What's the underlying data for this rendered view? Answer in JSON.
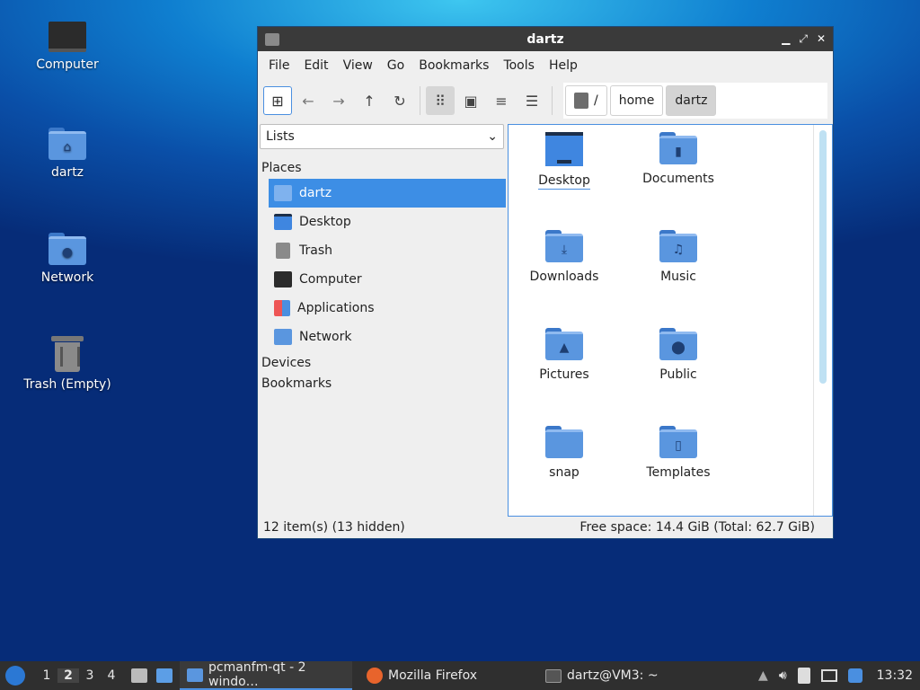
{
  "desktop": {
    "icons": [
      {
        "label": "Computer",
        "icon": "monitor-icon"
      },
      {
        "label": "dartz",
        "icon": "home-folder-icon"
      },
      {
        "label": "Network",
        "icon": "network-folder-icon"
      },
      {
        "label": "Trash (Empty)",
        "icon": "trash-icon"
      }
    ]
  },
  "window": {
    "title": "dartz",
    "menu": [
      "File",
      "Edit",
      "View",
      "Go",
      "Bookmarks",
      "Tools",
      "Help"
    ],
    "path": {
      "root": "/",
      "segments": [
        "home",
        "dartz"
      ]
    },
    "side": {
      "selector": "Lists",
      "groups": {
        "places": "Places",
        "devices": "Devices",
        "bookmarks": "Bookmarks"
      },
      "places": [
        "dartz",
        "Desktop",
        "Trash",
        "Computer",
        "Applications",
        "Network"
      ]
    },
    "files": [
      "Desktop",
      "Documents",
      "Downloads",
      "Music",
      "Pictures",
      "Public",
      "snap",
      "Templates"
    ],
    "status": {
      "left": "12 item(s) (13 hidden)",
      "right": "Free space: 14.4 GiB (Total: 62.7 GiB)"
    }
  },
  "taskbar": {
    "workspaces": [
      "1",
      "2",
      "3",
      "4"
    ],
    "active_workspace": "2",
    "tasks": [
      "pcmanfm-qt - 2 windo…",
      "Mozilla Firefox",
      "dartz@VM3: ~"
    ],
    "clock": "13:32"
  },
  "colors": {
    "accent": "#3d8ee5",
    "folder": "#5a96df",
    "titlebar": "#3a3a3a",
    "taskbar": "#2f2f2f"
  }
}
